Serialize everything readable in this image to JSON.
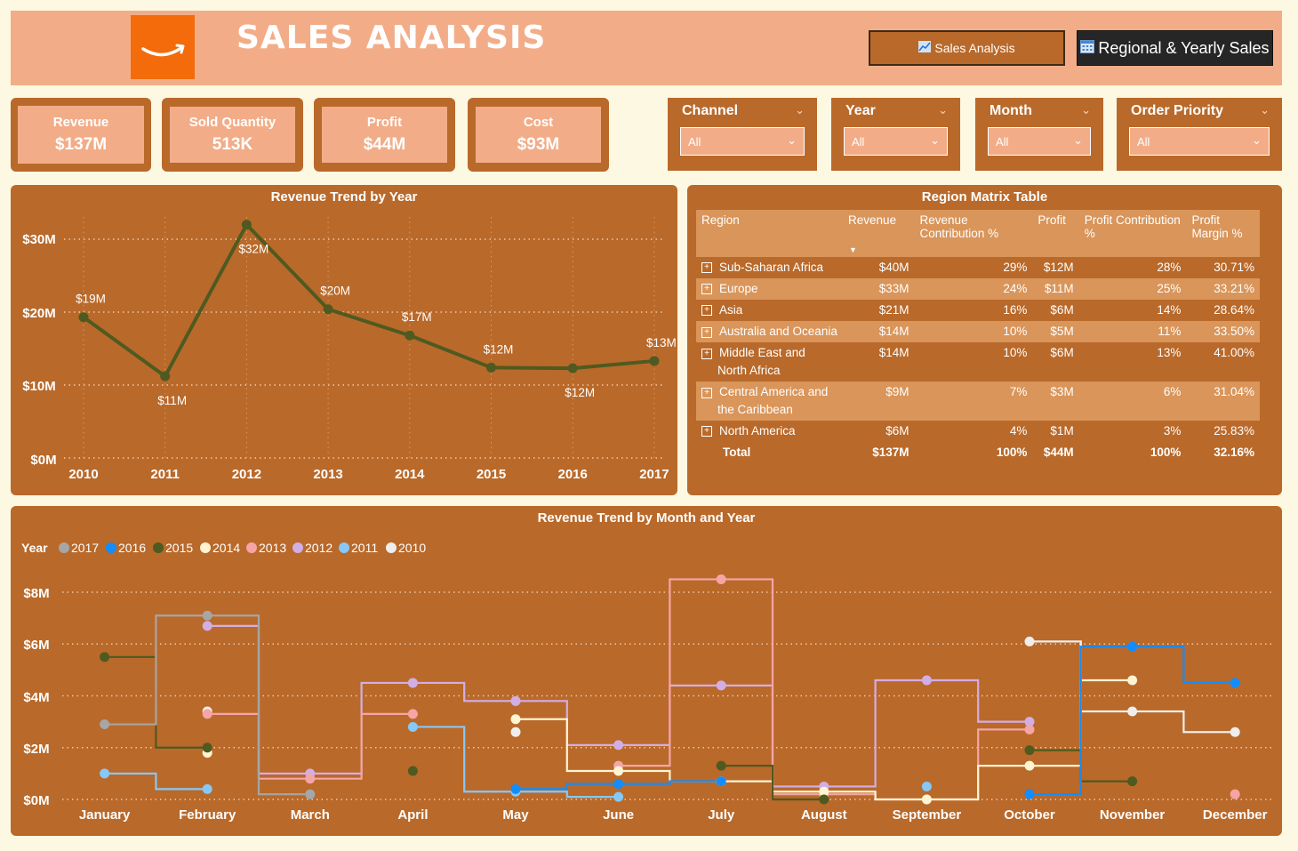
{
  "header": {
    "title": "SALES ANALYSIS",
    "nav_sales": "Sales Analysis",
    "nav_regional": "Regional & Yearly Sales"
  },
  "kpis": [
    {
      "label": "Revenue",
      "value": "$137M"
    },
    {
      "label": "Sold Quantity",
      "value": "513K"
    },
    {
      "label": "Profit",
      "value": "$44M"
    },
    {
      "label": "Cost",
      "value": "$93M"
    }
  ],
  "slicers": [
    {
      "title": "Channel",
      "value": "All"
    },
    {
      "title": "Year",
      "value": "All"
    },
    {
      "title": "Month",
      "value": "All"
    },
    {
      "title": "Order Priority",
      "value": "All"
    }
  ],
  "yearly_chart": {
    "title": "Revenue Trend by Year",
    "y_ticks": [
      "$30M",
      "$20M",
      "$10M",
      "$0M"
    ]
  },
  "matrix": {
    "title": "Region Matrix Table",
    "columns": [
      "Region",
      "Revenue",
      "Revenue Contribution %",
      "Profit",
      "Profit Contribution %",
      "Profit Margin %"
    ],
    "rows": [
      [
        "Sub-Saharan Africa",
        "$40M",
        "29%",
        "$12M",
        "28%",
        "30.71%"
      ],
      [
        "Europe",
        "$33M",
        "24%",
        "$11M",
        "25%",
        "33.21%"
      ],
      [
        "Asia",
        "$21M",
        "16%",
        "$6M",
        "14%",
        "28.64%"
      ],
      [
        "Australia and Oceania",
        "$14M",
        "10%",
        "$5M",
        "11%",
        "33.50%"
      ],
      [
        "Middle East and North Africa",
        "$14M",
        "10%",
        "$6M",
        "13%",
        "41.00%"
      ],
      [
        "Central America and the Caribbean",
        "$9M",
        "7%",
        "$3M",
        "6%",
        "31.04%"
      ],
      [
        "North America",
        "$6M",
        "4%",
        "$1M",
        "3%",
        "25.83%"
      ]
    ],
    "total": [
      "Total",
      "$137M",
      "100%",
      "$44M",
      "100%",
      "32.16%"
    ]
  },
  "monthly_chart": {
    "title": "Revenue Trend by Month and Year",
    "legend_title": "Year",
    "y_ticks": [
      "$8M",
      "$6M",
      "$4M",
      "$2M",
      "$0M"
    ]
  },
  "chart_data": [
    {
      "type": "line",
      "title": "Revenue Trend by Year",
      "x": [
        "2010",
        "2011",
        "2012",
        "2013",
        "2014",
        "2015",
        "2016",
        "2017"
      ],
      "series": [
        {
          "values": [
            19.3,
            11.2,
            32.0,
            20.4,
            16.8,
            12.4,
            12.3,
            13.3
          ],
          "labels": [
            "$19M",
            "$11M",
            "$32M",
            "$20M",
            "$17M",
            "$12M",
            "$12M",
            "$13M"
          ]
        }
      ],
      "ylim": [
        0,
        35
      ],
      "y_ticks": [
        0,
        10,
        20,
        30
      ],
      "color": "#4e5a20",
      "grid": true
    },
    {
      "type": "line",
      "title": "Revenue Trend by Month and Year",
      "x": [
        "January",
        "February",
        "March",
        "April",
        "May",
        "June",
        "July",
        "August",
        "September",
        "October",
        "November",
        "December"
      ],
      "step": true,
      "series": [
        {
          "name": "2017",
          "color": "#a6a6a6",
          "values": [
            2.9,
            7.1,
            0.2,
            null,
            null,
            null,
            null,
            null,
            null,
            null,
            null,
            null
          ]
        },
        {
          "name": "2016",
          "color": "#118dff",
          "values": [
            null,
            null,
            0.2,
            null,
            0.4,
            0.6,
            0.7,
            null,
            null,
            0.2,
            5.9,
            4.5
          ]
        },
        {
          "name": "2015",
          "color": "#4e5a20",
          "values": [
            5.5,
            2.0,
            null,
            1.1,
            null,
            null,
            1.3,
            0.0,
            null,
            1.9,
            0.7,
            null
          ]
        },
        {
          "name": "2014",
          "color": "#fff4d2",
          "values": [
            null,
            1.8,
            null,
            null,
            3.1,
            1.1,
            0.7,
            0.3,
            0.0,
            1.3,
            4.6,
            null
          ]
        },
        {
          "name": "2013",
          "color": "#f5a5a5",
          "values": [
            null,
            3.3,
            0.8,
            3.3,
            null,
            1.3,
            8.5,
            0.2,
            0.0,
            2.7,
            null,
            0.2
          ]
        },
        {
          "name": "2012",
          "color": "#d2aee6",
          "values": [
            null,
            6.7,
            1.0,
            4.5,
            3.8,
            2.1,
            4.4,
            0.5,
            4.6,
            3.0,
            null,
            null
          ]
        },
        {
          "name": "2011",
          "color": "#86c8f7",
          "values": [
            1.0,
            0.4,
            null,
            2.8,
            0.3,
            0.1,
            null,
            null,
            0.5,
            null,
            null,
            null
          ]
        },
        {
          "name": "2010",
          "color": "#eeeeee",
          "values": [
            null,
            3.4,
            null,
            null,
            2.6,
            null,
            null,
            null,
            null,
            6.1,
            3.4,
            2.6
          ]
        }
      ],
      "ylim": [
        0,
        9
      ],
      "y_ticks": [
        0,
        2,
        4,
        6,
        8
      ],
      "grid": true,
      "legend_position": "top-left"
    }
  ]
}
